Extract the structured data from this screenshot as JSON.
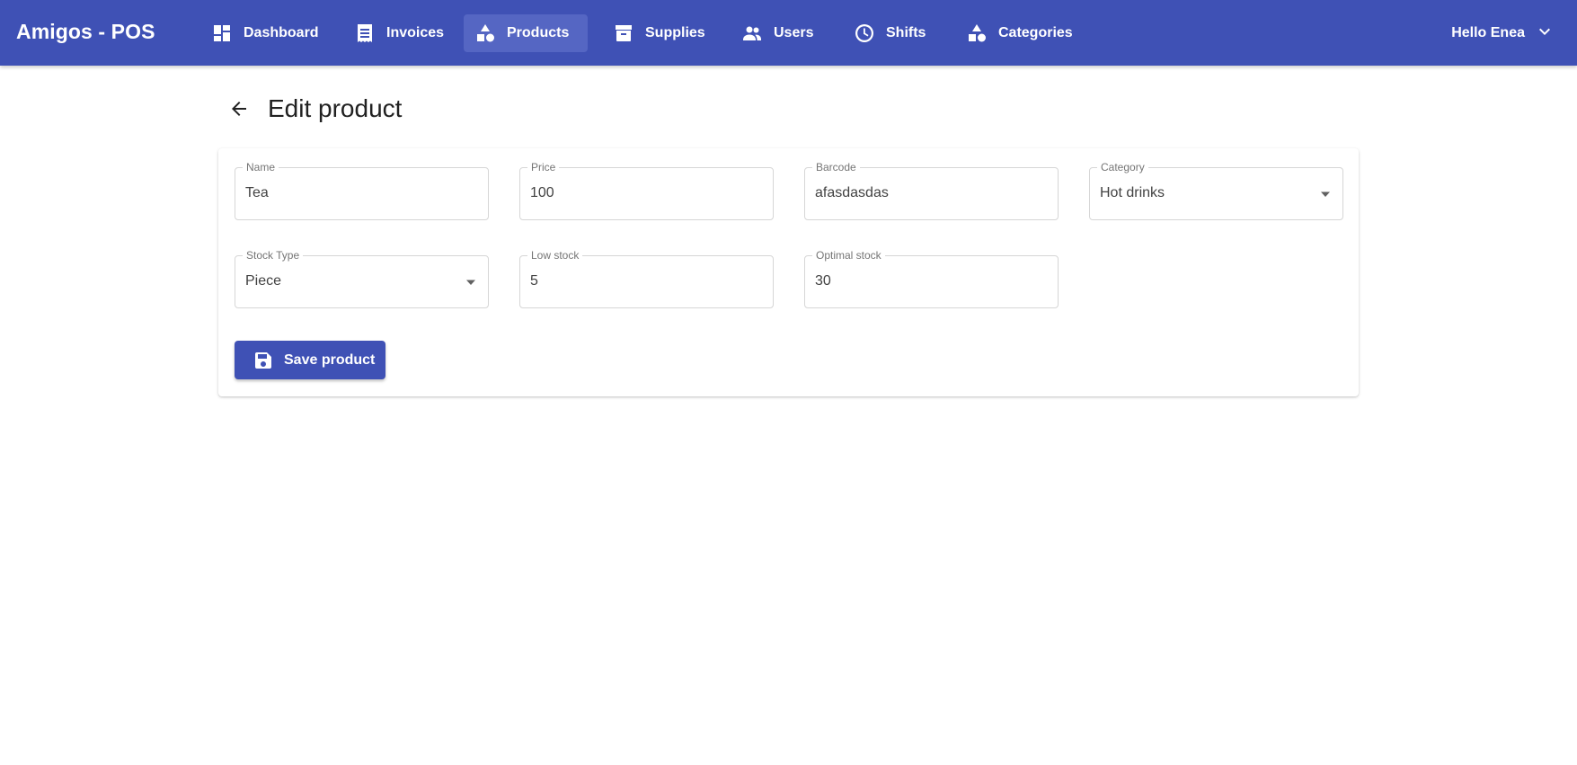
{
  "app": {
    "title": "Amigos - POS"
  },
  "nav": {
    "items": [
      {
        "label": "Dashboard",
        "icon": "dashboard-icon"
      },
      {
        "label": "Invoices",
        "icon": "receipt-icon"
      },
      {
        "label": "Products",
        "icon": "shapes-icon",
        "active": true
      },
      {
        "label": "Supplies",
        "icon": "archive-box-icon"
      },
      {
        "label": "Users",
        "icon": "users-icon"
      },
      {
        "label": "Shifts",
        "icon": "clock-icon"
      },
      {
        "label": "Categories",
        "icon": "shapes-icon"
      }
    ]
  },
  "user": {
    "greeting": "Hello Enea",
    "icon": "chevron-down-icon"
  },
  "page": {
    "title": "Edit product",
    "back_icon": "arrow-left-icon"
  },
  "form": {
    "name": {
      "label": "Name",
      "value": "Tea"
    },
    "price": {
      "label": "Price",
      "value": "100"
    },
    "barcode": {
      "label": "Barcode",
      "value": "afasdasdas"
    },
    "category": {
      "label": "Category",
      "value": "Hot drinks"
    },
    "stock_type": {
      "label": "Stock Type",
      "value": "Piece"
    },
    "low_stock": {
      "label": "Low stock",
      "value": "5"
    },
    "optimal_stock": {
      "label": "Optimal stock",
      "value": "30"
    },
    "save_label": "Save product",
    "save_icon": "floppy-disk-icon"
  },
  "colors": {
    "primary": "#3f51b5",
    "nav_active": "#5566c3",
    "background": "#ffffff"
  }
}
